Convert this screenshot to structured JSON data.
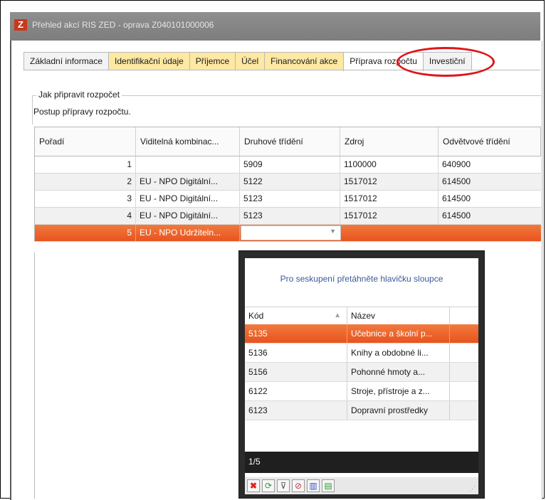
{
  "window": {
    "title": "Přehled akcí RIS ZED - oprava  Z040101000006",
    "logo": "Z"
  },
  "tabs": [
    {
      "label": "Základní informace",
      "style": "normal"
    },
    {
      "label": "Identifikační údaje",
      "style": "yellow"
    },
    {
      "label": "Příjemce",
      "style": "yellow"
    },
    {
      "label": "Účel",
      "style": "yellow"
    },
    {
      "label": "Financování akce",
      "style": "yellow"
    },
    {
      "label": "Příprava rozpočtu",
      "style": "active"
    },
    {
      "label": "Investiční",
      "style": "normal"
    }
  ],
  "section": {
    "legend": "Jak připravit rozpočet",
    "description": "Postup přípravy rozpočtu."
  },
  "grid": {
    "headers": [
      "Pořadí",
      "Viditelná kombinac...",
      "Druhové třídění",
      "Zdroj",
      "Odvětvové třídění"
    ],
    "rows": [
      {
        "poradi": "1",
        "kombinace": "",
        "druhove": "5909",
        "zdroj": "1100000",
        "odvetvove": "640900"
      },
      {
        "poradi": "2",
        "kombinace": "EU - NPO Digitální...",
        "druhove": "5122",
        "zdroj": "1517012",
        "odvetvove": "614500"
      },
      {
        "poradi": "3",
        "kombinace": "EU - NPO Digitální...",
        "druhove": "5123",
        "zdroj": "1517012",
        "odvetvove": "614500"
      },
      {
        "poradi": "4",
        "kombinace": "EU - NPO Digitální...",
        "druhove": "5123",
        "zdroj": "1517012",
        "odvetvove": "614500"
      }
    ],
    "selected_row": {
      "poradi": "5",
      "kombinace": "EU - NPO Udržiteln..."
    }
  },
  "dropdown": {
    "group_hint": "Pro seskupení přetáhněte hlavičku sloupce",
    "columns": [
      "Kód",
      "Název"
    ],
    "items": [
      {
        "kod": "5135",
        "nazev": "Učebnice a školní p..."
      },
      {
        "kod": "5136",
        "nazev": "Knihy a obdobné li..."
      },
      {
        "kod": "5156",
        "nazev": "Pohonné hmoty a..."
      },
      {
        "kod": "6122",
        "nazev": "Stroje, přístroje a z..."
      },
      {
        "kod": "6123",
        "nazev": "Dopravní prostředky"
      }
    ],
    "pager": "1/5",
    "toolbar_icons": [
      "delete-icon",
      "refresh-icon",
      "filter-icon",
      "clear-filter-icon",
      "columns-icon",
      "group-icon"
    ]
  },
  "colors": {
    "accent": "#e9531e",
    "tab_yellow": "#fde8a4",
    "highlight_ring": "#e0141b"
  }
}
